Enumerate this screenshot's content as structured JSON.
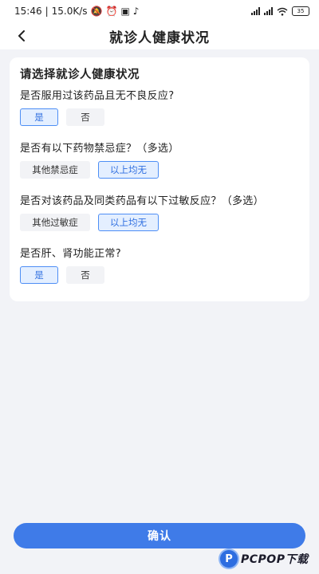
{
  "status_bar": {
    "time": "15:46",
    "speed": "15.0K/s",
    "battery": "35"
  },
  "nav": {
    "title": "就诊人健康状况"
  },
  "card": {
    "title": "请选择就诊人健康状况",
    "questions": [
      {
        "text": "是否服用过该药品且无不良反应?",
        "options": [
          {
            "label": "是",
            "selected": true
          },
          {
            "label": "否",
            "selected": false
          }
        ]
      },
      {
        "text": "是否有以下药物禁忌症？（多选）",
        "options": [
          {
            "label": "其他禁忌症",
            "selected": false
          },
          {
            "label": "以上均无",
            "selected": true
          }
        ]
      },
      {
        "text": "是否对该药品及同类药品有以下过敏反应？（多选）",
        "options": [
          {
            "label": "其他过敏症",
            "selected": false
          },
          {
            "label": "以上均无",
            "selected": true
          }
        ]
      },
      {
        "text": "是否肝、肾功能正常?",
        "options": [
          {
            "label": "是",
            "selected": true
          },
          {
            "label": "否",
            "selected": false
          }
        ]
      }
    ]
  },
  "footer": {
    "confirm_label": "确认"
  },
  "watermark": {
    "logo_letter": "P",
    "text": "PCPOP下载"
  },
  "colors": {
    "accent": "#3f7be8",
    "selected_bg": "#e4efff",
    "selected_border": "#4d8ef5",
    "page_bg": "#f2f3f7"
  }
}
